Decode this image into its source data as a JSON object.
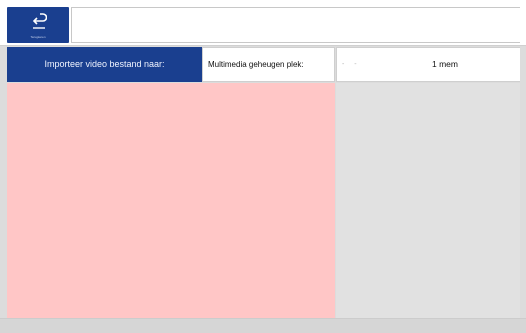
{
  "header": {
    "back_label": "Terugkeren",
    "title": ""
  },
  "import": {
    "button_label": "Importeer video bestand naar:"
  },
  "memory": {
    "label": "Multimedia geheugen plek:",
    "dashes": "- -",
    "value": "1 mem"
  },
  "colors": {
    "accent": "#1a3f8f",
    "preview": "#ffc6c6",
    "background": "#dcdcdc"
  },
  "icons": {
    "back": "return-arrow-icon"
  }
}
